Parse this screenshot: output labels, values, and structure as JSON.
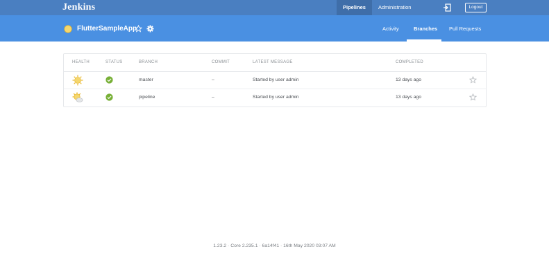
{
  "topbar": {
    "brand": "Jenkins",
    "nav": [
      "Pipelines",
      "Administration"
    ],
    "active_nav": "Pipelines",
    "logout_label": "Logout",
    "color": "#4a7fc1"
  },
  "subbar": {
    "app_name": "FlutterSampleApp",
    "tabs": [
      "Activity",
      "Branches",
      "Pull Requests"
    ],
    "active_tab": "Branches",
    "color": "#4a90e2"
  },
  "table": {
    "columns": [
      "HEALTH",
      "STATUS",
      "BRANCH",
      "COMMIT",
      "LATEST MESSAGE",
      "COMPLETED"
    ],
    "rows": [
      {
        "health": "sunny-icon",
        "status": "success",
        "branch": "master",
        "commit": "–",
        "message": "Started by user admin",
        "completed": "13 days ago"
      },
      {
        "health": "partly-sunny-icon",
        "status": "success",
        "branch": "pipeline",
        "commit": "–",
        "message": "Started by user admin",
        "completed": "13 days ago"
      }
    ]
  },
  "footer": "1.23.2 · Core 2.235.1 · 6a14f41 · 16th May 2020 03:07 AM",
  "colors": {
    "success": "#78b037",
    "sun": "#f5c542"
  }
}
